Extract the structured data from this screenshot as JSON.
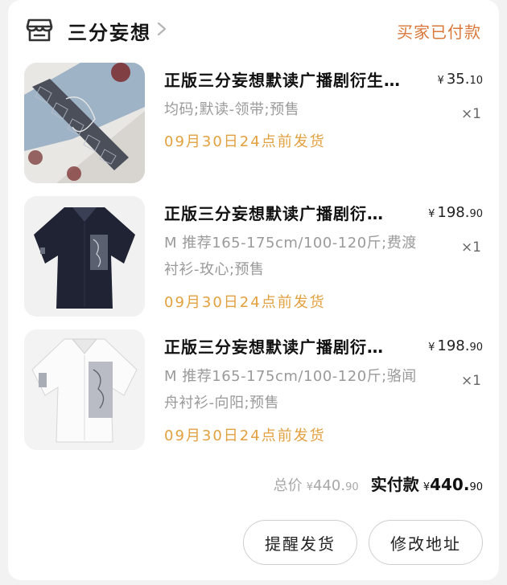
{
  "store": {
    "name": "三分妄想",
    "order_status": "买家已付款"
  },
  "items": [
    {
      "title": "正版三分妄想默读广播剧衍生…",
      "price_currency": "¥",
      "price_int": "35.",
      "price_dec": "10",
      "spec_lines": [
        "均码;默读-领带;预售"
      ],
      "quantity": "×1",
      "ship_note": "09月30日24点前发货"
    },
    {
      "title": "正版三分妄想默读广播剧衍…",
      "price_currency": "¥",
      "price_int": "198.",
      "price_dec": "90",
      "spec_lines": [
        "M 推荐165-175cm/100-120斤;费渡",
        "衬衫-玫心;预售"
      ],
      "quantity": "×1",
      "ship_note": "09月30日24点前发货"
    },
    {
      "title": "正版三分妄想默读广播剧衍…",
      "price_currency": "¥",
      "price_int": "198.",
      "price_dec": "90",
      "spec_lines": [
        "M 推荐165-175cm/100-120斤;骆闻",
        "舟衬衫-向阳;预售"
      ],
      "quantity": "×1",
      "ship_note": "09月30日24点前发货"
    }
  ],
  "totals": {
    "total_label": "总价",
    "total_currency": "¥",
    "total_int": "440.",
    "total_dec": "90",
    "paid_label": "实付款",
    "paid_currency": "¥",
    "paid_int": "440.",
    "paid_dec": "90"
  },
  "actions": {
    "remind_label": "提醒发货",
    "address_label": "修改地址"
  },
  "colors": {
    "status": "#d9783a",
    "ship_note": "#e2a03f",
    "spec_text": "#9a9a9a"
  },
  "icons": {
    "store": "store-icon",
    "chevron": "chevron-right-icon"
  }
}
